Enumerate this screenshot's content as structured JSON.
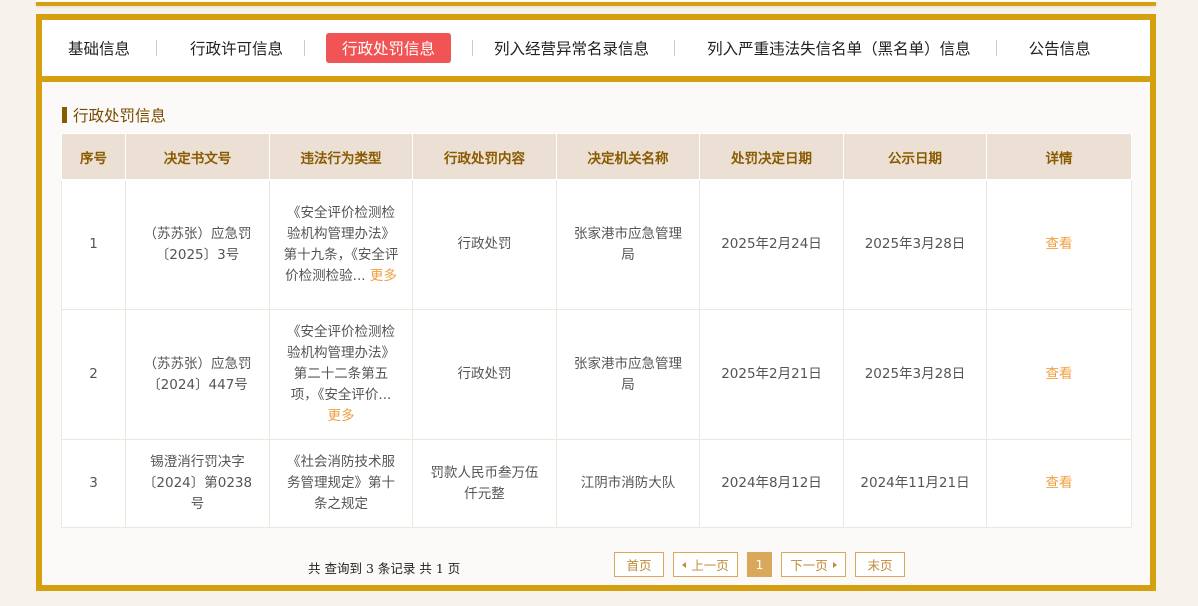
{
  "tabs": [
    {
      "label": "基础信息"
    },
    {
      "label": "行政许可信息"
    },
    {
      "label": "行政处罚信息",
      "active": true
    },
    {
      "label": "列入经营异常名录信息"
    },
    {
      "label": "列入严重违法失信名单（黑名单）信息"
    },
    {
      "label": "公告信息"
    }
  ],
  "section": {
    "title": "行政处罚信息"
  },
  "table": {
    "headers": [
      "序号",
      "决定书文号",
      "违法行为类型",
      "行政处罚内容",
      "决定机关名称",
      "处罚决定日期",
      "公示日期",
      "详情"
    ],
    "rows": [
      {
        "no": "1",
        "doc_no": "（苏苏张）应急罚〔2025〕3号",
        "violation": "《安全评价检测检验机构管理办法》第十九条，《安全评价检测检验...",
        "more": "更多",
        "content": "行政处罚",
        "authority": "张家港市应急管理局",
        "decision_date": "2025年2月24日",
        "publish_date": "2025年3月28日",
        "detail": "查看"
      },
      {
        "no": "2",
        "doc_no": "（苏苏张）应急罚〔2024〕447号",
        "violation": "《安全评价检测检验机构管理办法》第二十二条第五项，《安全评价...",
        "more": "更多",
        "content": "行政处罚",
        "authority": "张家港市应急管理局",
        "decision_date": "2025年2月21日",
        "publish_date": "2025年3月28日",
        "detail": "查看"
      },
      {
        "no": "3",
        "doc_no": "锡澄消行罚决字〔2024〕第0238号",
        "violation": "《社会消防技术服务管理规定》第十条之规定",
        "more": "",
        "content": "罚款人民币叁万伍仟元整",
        "authority": "江阴市消防大队",
        "decision_date": "2024年8月12日",
        "publish_date": "2024年11月21日",
        "detail": "查看"
      }
    ]
  },
  "pager": {
    "summary": "共 查询到 3 条记录 共 1 页",
    "first": "首页",
    "prev": "上一页",
    "current": "1",
    "next": "下一页",
    "last": "末页"
  },
  "colors": {
    "accent": "#d4a00f",
    "active_tab": "#f15454",
    "link": "#f0a040",
    "header_bg": "#ebe0d3"
  }
}
